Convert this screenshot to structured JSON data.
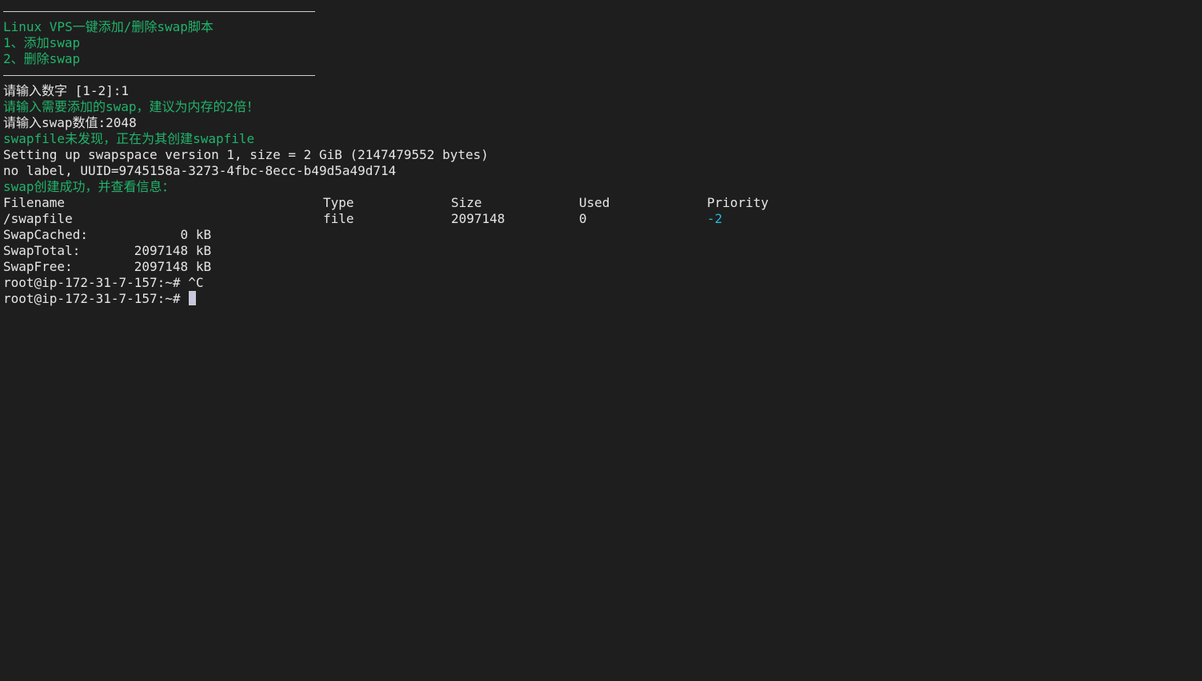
{
  "colors": {
    "background": "#1e1e1e",
    "text": "#e6e6e6",
    "green": "#21b36b",
    "cyan": "#22b8d6",
    "cursor": "#c8c8dc"
  },
  "menu": {
    "title": "Linux VPS一键添加/删除swap脚本",
    "option1": "1、添加swap",
    "option2": "2、删除swap"
  },
  "session": {
    "prompt_choice": "请输入数字 [1-2]:1",
    "hint_size": "请输入需要添加的swap，建议为内存的2倍！",
    "prompt_size": "请输入swap数值:2048",
    "not_found": "swapfile未发现，正在为其创建swapfile",
    "mkswap_setup": "Setting up swapspace version 1, size = 2 GiB (2147479552 bytes)",
    "mkswap_uuid": "no label, UUID=9745158a-3273-4fbc-8ecc-b49d5a49d714",
    "success": "swap创建成功，并查看信息："
  },
  "swaps_table": {
    "headers": [
      "Filename",
      "Type",
      "Size",
      "Used",
      "Priority"
    ],
    "rows": [
      [
        "/swapfile",
        "file",
        "2097148",
        "0",
        "-2"
      ]
    ]
  },
  "meminfo": [
    "SwapCached:            0 kB",
    "SwapTotal:       2097148 kB",
    "SwapFree:        2097148 kB"
  ],
  "shell": {
    "line1": "root@ip-172-31-7-157:~# ^C",
    "prompt": "root@ip-172-31-7-157:~# "
  }
}
